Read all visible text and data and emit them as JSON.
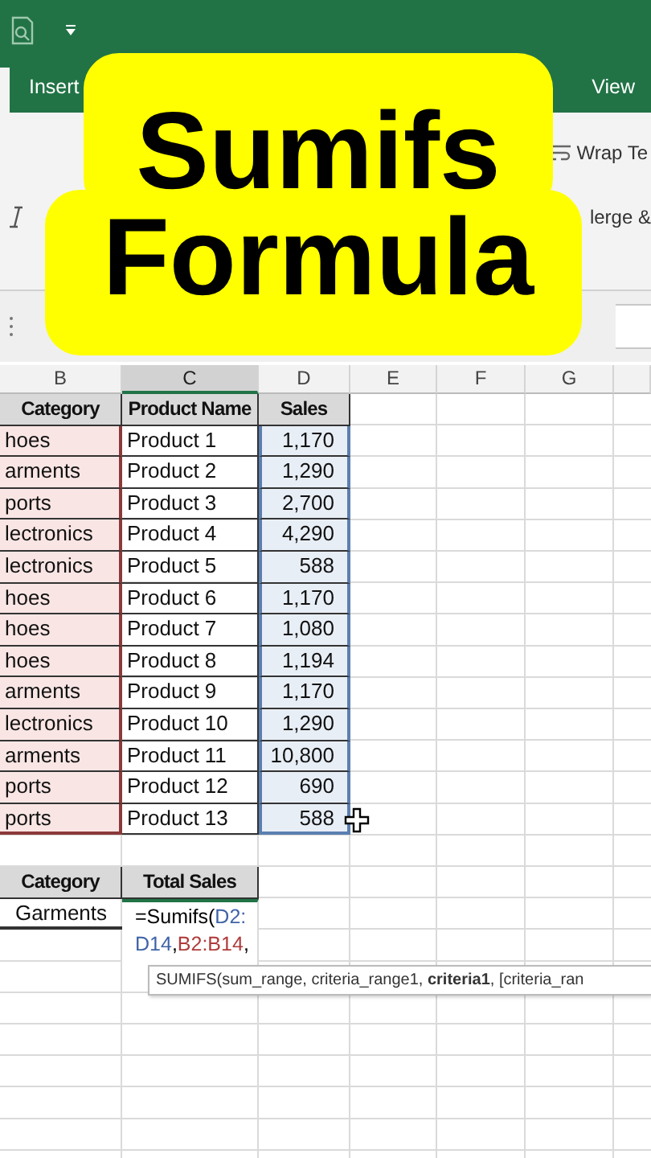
{
  "ribbon": {
    "tabs": [
      {
        "label": "Insert",
        "selected": false
      },
      {
        "label": "View",
        "selected": false
      }
    ],
    "commands": [
      {
        "label": "Wrap Te"
      },
      {
        "label": "lerge &"
      }
    ]
  },
  "columns": [
    "B",
    "C",
    "D",
    "E",
    "F",
    "G"
  ],
  "table": {
    "header": [
      "Category",
      "Product Name",
      "Sales"
    ],
    "rows": [
      [
        "hoes",
        "Product 1",
        "1,170"
      ],
      [
        "arments",
        "Product 2",
        "1,290"
      ],
      [
        "ports",
        "Product 3",
        "2,700"
      ],
      [
        "lectronics",
        "Product 4",
        "4,290"
      ],
      [
        "lectronics",
        "Product 5",
        "588"
      ],
      [
        "hoes",
        "Product 6",
        "1,170"
      ],
      [
        "hoes",
        "Product 7",
        "1,080"
      ],
      [
        "hoes",
        "Product 8",
        "1,194"
      ],
      [
        "arments",
        "Product 9",
        "1,170"
      ],
      [
        "lectronics",
        "Product 10",
        "1,290"
      ],
      [
        "arments",
        "Product 11",
        "10,800"
      ],
      [
        "ports",
        "Product 12",
        "690"
      ],
      [
        "ports",
        "Product 13",
        "588"
      ]
    ]
  },
  "summary": {
    "header": [
      "Category",
      "Total Sales"
    ],
    "criteria": "Garments",
    "formula_lines": [
      [
        {
          "text": "=Sumifs(",
          "color": "#000000"
        },
        {
          "text": "D2:",
          "color": "#3f63a8"
        }
      ],
      [
        {
          "text": "D14",
          "color": "#3f63a8"
        },
        {
          "text": ",",
          "color": "#000000"
        },
        {
          "text": "B2:B14",
          "color": "#b03a3a"
        },
        {
          "text": ",",
          "color": "#000000"
        }
      ]
    ]
  },
  "tooltip": "SUMIFS(sum_range, criteria_range1, **criteria1**, [criteria_ran",
  "overlay_title": "Sumifs Formula"
}
